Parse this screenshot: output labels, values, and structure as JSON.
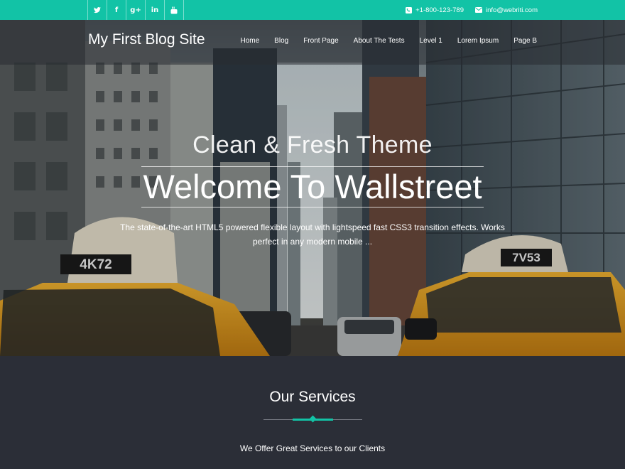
{
  "topbar": {
    "social": [
      {
        "icon": "twitter-icon",
        "glyph": "🐦"
      },
      {
        "icon": "facebook-icon",
        "glyph": "f"
      },
      {
        "icon": "google-plus-icon",
        "glyph": "g+"
      },
      {
        "icon": "linkedin-icon",
        "glyph": "in"
      },
      {
        "icon": "youtube-icon",
        "glyph": "▶"
      }
    ],
    "phone": "+1-800-123-789",
    "email": "info@webriti.com"
  },
  "header": {
    "site_title": "My First Blog Site",
    "menu": [
      "Home",
      "Blog",
      "Front Page",
      "About The Tests",
      "Level 1",
      "Lorem Ipsum",
      "Page B"
    ]
  },
  "hero": {
    "subtitle": "Clean & Fresh Theme",
    "title": "Welcome To Wallstreet",
    "description": "The state-of-the-art HTML5 powered flexible layout with lightspeed fast CSS3 transition effects. Works perfect in any modern mobile ...",
    "taxi_left_plate": "4K72",
    "taxi_right_plate": "7V53"
  },
  "services": {
    "title": "Our Services",
    "description": "We Offer Great Services to our Clients"
  },
  "colors": {
    "accent": "#12c3a6",
    "dark_bg": "#2b2e37"
  }
}
